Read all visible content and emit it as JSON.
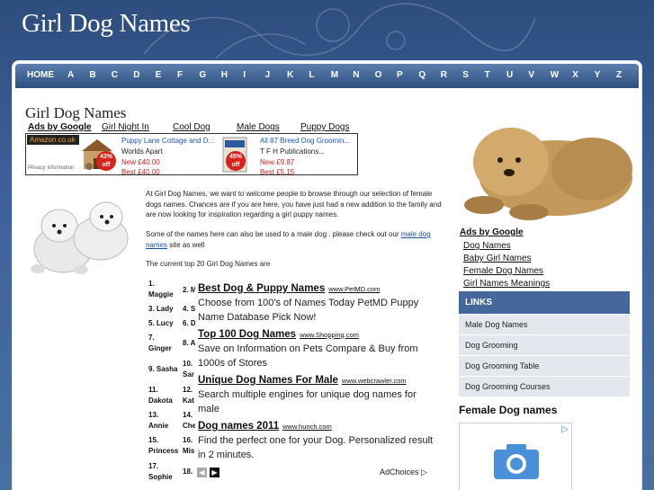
{
  "header": {
    "site_title": "Girl Dog Names"
  },
  "nav": {
    "items": [
      "HOME",
      "A",
      "B",
      "C",
      "D",
      "E",
      "F",
      "G",
      "H",
      "I",
      "J",
      "K",
      "L",
      "M",
      "N",
      "O",
      "P",
      "Q",
      "R",
      "S",
      "T",
      "U",
      "V",
      "W",
      "X",
      "Y",
      "Z"
    ]
  },
  "main": {
    "page_title": "Girl Dog Names",
    "top_links": {
      "ads_label": "Ads by Google",
      "items": [
        "Girl Night In",
        "Cool Dog",
        "Male Dogs",
        "Puppy Dogs"
      ]
    },
    "amazon_ad": {
      "brand": "Amazon.co.uk",
      "privacy": "Privacy Information",
      "products": [
        {
          "title": "Puppy Lane Cottage and D...",
          "maker": "Worlds Apart",
          "new": "New £40.00",
          "best": "Best £40.00",
          "badge_pct": "43%",
          "badge_word": "off"
        },
        {
          "title": "All 87 Breed Dog Groomin...",
          "maker": "T F H Publications...",
          "new": "New £9.87",
          "best": "Best £5.15",
          "badge_pct": "45%",
          "badge_word": "off"
        }
      ]
    },
    "intro_p1": "At Girl Dog Names, we want to welcome people to browse through our selection of female dogs names. Chances are if you are here, you have just had a new addition to the family and are now looking for inspiration regarding a girl puppy names.",
    "intro_p2_before": "Some of the names here can also be used to a male dog . please check out our ",
    "intro_p2_link": "male dog names",
    "intro_p2_after": " site as well",
    "intro_p3": "The current top 20 Girl Dog Names are",
    "names_col1": [
      {
        "n": "1.",
        "name": "Maggie"
      },
      {
        "n": "3.",
        "name": "Lady"
      },
      {
        "n": "5.",
        "name": "Lucy"
      },
      {
        "n": "7.",
        "name": "Ginger"
      },
      {
        "n": "9.",
        "name": "Sasha"
      },
      {
        "n": "11.",
        "name": "Dakota"
      },
      {
        "n": "13.",
        "name": "Annie"
      },
      {
        "n": "15.",
        "name": "Princess"
      },
      {
        "n": "17.",
        "name": "Sophie"
      }
    ],
    "names_col2": [
      {
        "n": "2.",
        "name": "M"
      },
      {
        "n": "4.",
        "name": "S"
      },
      {
        "n": "6.",
        "name": "D"
      },
      {
        "n": "8.",
        "name": "A"
      },
      {
        "n": "10.",
        "name": "Sar"
      },
      {
        "n": "12.",
        "name": "Kat"
      },
      {
        "n": "14.",
        "name": "Che"
      },
      {
        "n": "16.",
        "name": "Mis"
      },
      {
        "n": "18.",
        "name": ""
      }
    ],
    "text_ads": [
      {
        "headline": "Best Dog & Puppy Names",
        "url": "www.PetMD.com",
        "desc": "Choose from 100's of Names Today PetMD Puppy Name Database Pick Now!"
      },
      {
        "headline": "Top 100 Dog Names",
        "url": "www.Shopping.com",
        "desc": "Save on Information on Pets Compare & Buy from 1000s of Stores"
      },
      {
        "headline": "Unique Dog Names For Male",
        "url": "www.webcrawler.com",
        "desc": "Search multiple engines for unique dog names for male"
      },
      {
        "headline": "Dog names 2011",
        "url": "www.hunch.com",
        "desc": "Find the perfect one for your Dog. Personalized result in 2 minutes."
      }
    ],
    "adchoices": "AdChoices"
  },
  "sidebar": {
    "ads_label": "Ads by Google",
    "ad_links": [
      "Dog Names",
      "Baby Girl Names",
      "Female Dog Names",
      "Girl Names Meanings"
    ],
    "links_header": "LINKS",
    "links": [
      "Male Dog Names",
      "Dog Grooming",
      "Dog Grooming Table",
      "Dog Grooming Courses"
    ],
    "female_heading": "Female Dog names"
  },
  "colors": {
    "nav_top": "#5a7fae",
    "nav_bottom": "#2f4f81",
    "link_blue": "#1a57c7",
    "price_red": "#d12020",
    "links_header": "#46679c"
  }
}
